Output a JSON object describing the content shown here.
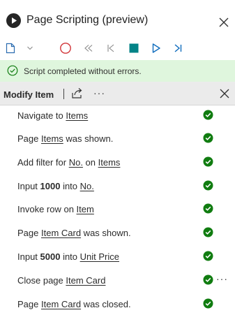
{
  "window": {
    "title": "Page Scripting (preview)"
  },
  "toolbar": {
    "buttons": [
      {
        "icon": "new-document-icon",
        "label": ""
      },
      {
        "icon": "chevron-down-icon",
        "label": ""
      },
      {
        "icon": "record-icon",
        "label": ""
      },
      {
        "icon": "rewind-icon",
        "label": ""
      },
      {
        "icon": "step-back-icon",
        "label": ""
      },
      {
        "icon": "stop-icon",
        "label": ""
      },
      {
        "icon": "play-icon",
        "label": ""
      },
      {
        "icon": "step-forward-icon",
        "label": ""
      }
    ],
    "colors": {
      "record": "#d13438",
      "blue": "#0f6cbd",
      "stop": "#038387"
    }
  },
  "status": {
    "message": "Script completed without errors.",
    "color": "#dff6dd",
    "icon": "check-circle-icon"
  },
  "script": {
    "name": "Modify Item"
  },
  "steps": [
    {
      "parts": [
        [
          "t",
          "Navigate to "
        ],
        [
          "u",
          "Items"
        ]
      ],
      "status": "success"
    },
    {
      "parts": [
        [
          "t",
          "Page "
        ],
        [
          "u",
          "Items"
        ],
        [
          "t",
          " was shown."
        ]
      ],
      "status": "success"
    },
    {
      "parts": [
        [
          "t",
          "Add filter for "
        ],
        [
          "u",
          "No."
        ],
        [
          "t",
          " on "
        ],
        [
          "u",
          "Items"
        ]
      ],
      "status": "success"
    },
    {
      "parts": [
        [
          "t",
          "Input "
        ],
        [
          "b",
          "1000"
        ],
        [
          "t",
          " into "
        ],
        [
          "u",
          "No."
        ]
      ],
      "status": "success"
    },
    {
      "parts": [
        [
          "t",
          "Invoke row on "
        ],
        [
          "u",
          "Item"
        ]
      ],
      "status": "success"
    },
    {
      "parts": [
        [
          "t",
          "Page "
        ],
        [
          "u",
          "Item Card"
        ],
        [
          "t",
          " was shown."
        ]
      ],
      "status": "success"
    },
    {
      "parts": [
        [
          "t",
          "Input "
        ],
        [
          "b",
          "5000"
        ],
        [
          "t",
          " into "
        ],
        [
          "u",
          "Unit Price"
        ]
      ],
      "status": "success"
    },
    {
      "parts": [
        [
          "t",
          "Close page "
        ],
        [
          "u",
          "Item Card"
        ]
      ],
      "status": "success",
      "more": "···"
    },
    {
      "parts": [
        [
          "t",
          "Page "
        ],
        [
          "u",
          "Item Card"
        ],
        [
          "t",
          " was closed."
        ]
      ],
      "status": "success"
    }
  ],
  "success_color": "#107c10"
}
